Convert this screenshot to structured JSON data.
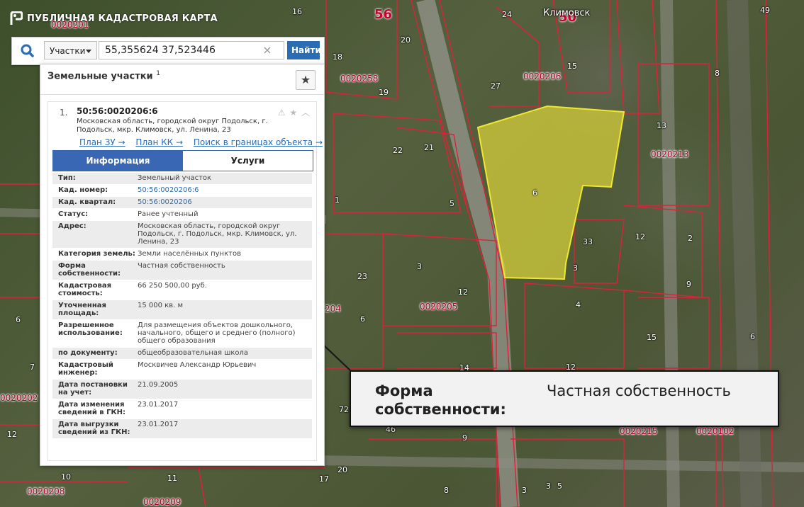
{
  "app": {
    "title": "ПУБЛИЧНАЯ КАДАСТРОВАЯ КАРТА"
  },
  "search": {
    "type_label": "Участки",
    "query": "55,355624 37,523446",
    "clear": "×",
    "submit_label": "Найти"
  },
  "panel": {
    "title": "Земельные участки",
    "count": "1",
    "result": {
      "index": "1.",
      "cad_number": "50:56:0020206:6",
      "address": "Московская область, городской округ Подольск, г. Подольск, мкр. Климовск, ул. Ленина, 23",
      "links": [
        "План ЗУ →",
        "План КК →",
        "Поиск в границах объекта →"
      ],
      "tabs": [
        "Информация",
        "Услуги"
      ],
      "rows": [
        {
          "k": "Тип:",
          "v": "Земельный участок"
        },
        {
          "k": "Кад. номер:",
          "v": "50:56:0020206:6"
        },
        {
          "k": "Кад. квартал:",
          "v": "50:56:0020206"
        },
        {
          "k": "Статус:",
          "v": "Ранее учтенный"
        },
        {
          "k": "Адрес:",
          "v": "Московская область, городской округ Подольск, г. Подольск, мкр. Климовск, ул. Ленина, 23"
        },
        {
          "k": "Категория земель:",
          "v": "Земли населённых пунктов"
        },
        {
          "k": "Форма собственности:",
          "v": "Частная собственность"
        },
        {
          "k": "Кадастровая стоимость:",
          "v": "66 250 500,00 руб."
        },
        {
          "k": "Уточненная площадь:",
          "v": "15 000 кв. м"
        },
        {
          "k": "Разрешенное использование:",
          "v": "Для размещения объектов дошкольного, начального, общего и среднего (полного) общего образования"
        },
        {
          "k": "по документу:",
          "v": "общеобразовательная школа"
        },
        {
          "k": "Кадастровый инженер:",
          "v": "Москвичев Александр Юрьевич"
        },
        {
          "k": "Дата постановки на учет:",
          "v": "21.09.2005"
        },
        {
          "k": "Дата изменения сведений в ГКН:",
          "v": "23.01.2017"
        },
        {
          "k": "Дата выгрузки сведений из ГКН:",
          "v": "23.01.2017"
        }
      ]
    }
  },
  "callout": {
    "key": "Форма собственности:",
    "value": "Частная собственность"
  },
  "map": {
    "town": "Климовск",
    "parcel_label": "6",
    "quarters": [
      "0020201",
      "0020258",
      "0020206",
      "0020213",
      "0020205",
      "0020202",
      "0020208",
      "0020209",
      "0020215",
      "0020102",
      "204"
    ],
    "big_labels": [
      "56",
      "50"
    ],
    "house_numbers": [
      "16",
      "24",
      "49",
      "20",
      "15",
      "18",
      "19",
      "27",
      "22",
      "21",
      "13",
      "8",
      "1",
      "5",
      "2",
      "33",
      "3",
      "12",
      "9",
      "4",
      "23",
      "6",
      "10",
      "14",
      "3",
      "8",
      "12",
      "3",
      "6",
      "12",
      "9",
      "7",
      "6",
      "3",
      "5",
      "20",
      "17",
      "11",
      "15",
      "12",
      "72",
      "46"
    ],
    "parcel_color": "#d9d23a",
    "boundary_color": "#e0203a"
  },
  "colors": {
    "accent": "#2a6db5",
    "tab_active": "#3a67b4"
  }
}
